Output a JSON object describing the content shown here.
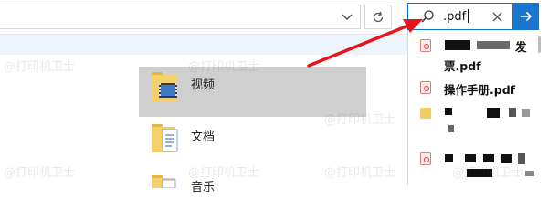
{
  "search": {
    "value": ".pdf"
  },
  "files": [
    {
      "name": "视频",
      "icon": "video-folder-icon",
      "selected": true
    },
    {
      "name": "文档",
      "icon": "documents-folder-icon",
      "selected": false
    },
    {
      "name": "音乐",
      "icon": "music-folder-icon",
      "selected": false
    }
  ],
  "suggestions": [
    {
      "line1": "发",
      "line2": "票.pdf",
      "icon": "pdf-icon",
      "redacted": true
    },
    {
      "line1": "操作手册.pdf",
      "icon": "pdf-icon",
      "redacted": false
    },
    {
      "line1": "",
      "icon": "folder-icon",
      "redacted": true
    },
    {
      "line1": "",
      "icon": "pdf-icon",
      "redacted": true
    }
  ],
  "watermark": "@打印机卫士",
  "colors": {
    "accent": "#1876d1",
    "arrow": "#e8141b",
    "selection": "#cfcfcf"
  }
}
